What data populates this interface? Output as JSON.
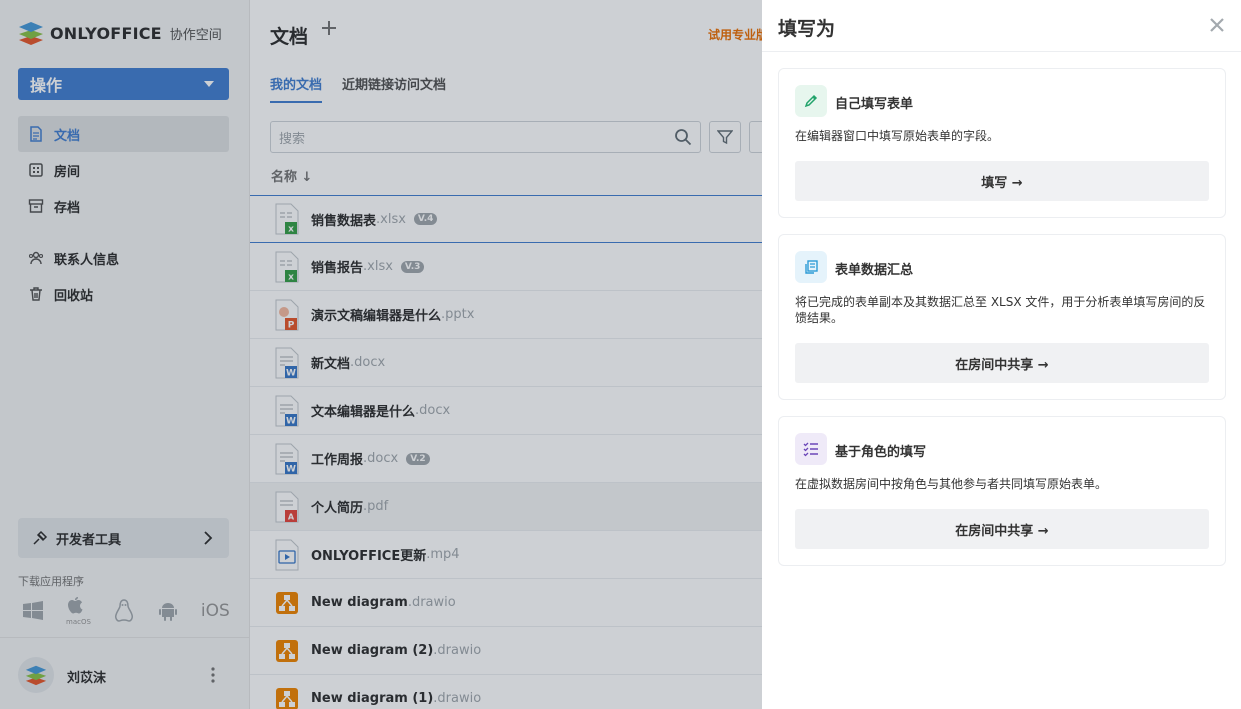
{
  "app": {
    "logo_name": "ONLYOFFICE",
    "logo_sub": "协作空间"
  },
  "sidebar": {
    "actions_label": "操作",
    "items": [
      {
        "label": "文档",
        "icon": "document-icon"
      },
      {
        "label": "房间",
        "icon": "rooms-icon"
      },
      {
        "label": "存档",
        "icon": "archive-icon"
      },
      {
        "label": "联系人信息",
        "icon": "contacts-icon"
      },
      {
        "label": "回收站",
        "icon": "trash-icon"
      }
    ],
    "dev_tools_label": "开发者工具",
    "download_label": "下载应用程序",
    "macos_label": "macOS",
    "ios_label": "iOS",
    "user_name": "刘苡沫"
  },
  "main": {
    "title": "文档",
    "trial_text": "试用专业版",
    "tabs": [
      {
        "label": "我的文档"
      },
      {
        "label": "近期链接访问文档"
      }
    ],
    "search_placeholder": "搜索",
    "column_name": "名称 ↓",
    "files": [
      {
        "name": "销售数据表",
        "ext": ".xlsx",
        "version": "V.4",
        "type": "xlsx"
      },
      {
        "name": "销售报告",
        "ext": ".xlsx",
        "version": "V.3",
        "type": "xlsx"
      },
      {
        "name": "演示文稿编辑器是什么",
        "ext": ".pptx",
        "version": "",
        "type": "pptx"
      },
      {
        "name": "新文档",
        "ext": ".docx",
        "version": "",
        "type": "docx"
      },
      {
        "name": "文本编辑器是什么",
        "ext": ".docx",
        "version": "",
        "type": "docx"
      },
      {
        "name": "工作周报",
        "ext": ".docx",
        "version": "V.2",
        "type": "docx"
      },
      {
        "name": "个人简历",
        "ext": ".pdf",
        "version": "",
        "type": "pdf"
      },
      {
        "name": "ONLYOFFICE更新",
        "ext": ".mp4",
        "version": "",
        "type": "mp4"
      },
      {
        "name": "New diagram",
        "ext": ".drawio",
        "version": "",
        "type": "drawio"
      },
      {
        "name": "New diagram (2)",
        "ext": ".drawio",
        "version": "",
        "type": "drawio"
      },
      {
        "name": "New diagram (1)",
        "ext": ".drawio",
        "version": "",
        "type": "drawio"
      }
    ]
  },
  "panel": {
    "title": "填写为",
    "cards": [
      {
        "title": "自己填写表单",
        "desc": "在编辑器窗口中填写原始表单的字段。",
        "button": "填写 →",
        "icon": "pencil-icon",
        "icon_color": "#22a36b"
      },
      {
        "title": "表单数据汇总",
        "desc": "将已完成的表单副本及其数据汇总至 XLSX 文件，用于分析表单填写房间的反馈结果。",
        "button": "在房间中共享 →",
        "icon": "copy-forms-icon",
        "icon_color": "#2d9bd6"
      },
      {
        "title": "基于角色的填写",
        "desc": "在虚拟数据房间中按角色与其他参与者共同填写原始表单。",
        "button": "在房间中共享 →",
        "icon": "role-list-icon",
        "icon_color": "#6b46b8"
      }
    ]
  },
  "colors": {
    "accent": "#4781d1",
    "trial": "#ed7309"
  }
}
